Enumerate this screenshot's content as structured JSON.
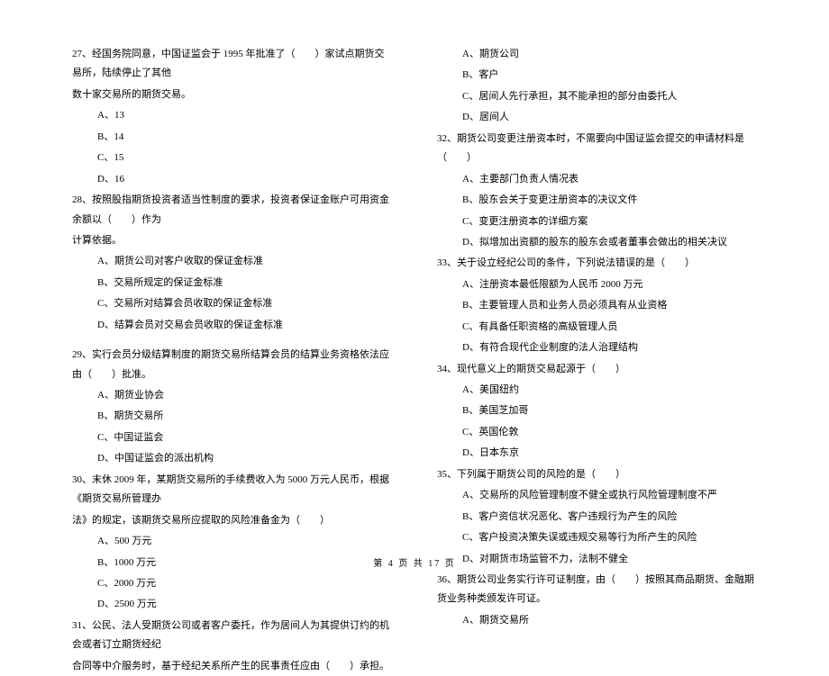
{
  "left_col": {
    "q27": {
      "text_l1": "27、经国务院同意，中国证监会于 1995 年批准了（　　）家试点期货交易所，陆续停止了其他",
      "text_l2": "数十家交易所的期货交易。",
      "opts": [
        "A、13",
        "B、14",
        "C、15",
        "D、16"
      ]
    },
    "q28": {
      "text_l1": "28、按照股指期货投资者适当性制度的要求，投资者保证金账户可用资金余额以（　　）作为",
      "text_l2": "计算依据。",
      "opts": [
        "A、期货公司对客户收取的保证金标准",
        "B、交易所规定的保证金标准",
        "C、交易所对结算会员收取的保证金标准",
        "D、结算会员对交易会员收取的保证金标准"
      ]
    },
    "q29": {
      "text": "29、实行会员分级结算制度的期货交易所结算会员的结算业务资格依法应由（　　）批准。",
      "opts": [
        "A、期货业协会",
        "B、期货交易所",
        "C、中国证监会",
        "D、中国证监会的派出机构"
      ]
    },
    "q30": {
      "text_l1": "30、末休 2009 年，某期货交易所的手续费收入为 5000 万元人民币，根据《期货交易所管理办",
      "text_l2": "法》的规定，该期货交易所应提取的风险准备金为（　　）",
      "opts": [
        "A、500 万元",
        "B、1000 万元",
        "C、2000 万元",
        "D、2500 万元"
      ]
    },
    "q31": {
      "text_l1": "31、公民、法人受期货公司或者客户委托，作为居间人为其提供订约的机会或者订立期货经纪",
      "text_l2": "合同等中介服务时，基于经纪关系所产生的民事责任应由（　　）承担。"
    }
  },
  "right_col": {
    "q31_opts": [
      "A、期货公司",
      "B、客户",
      "C、居间人先行承担，其不能承担的部分由委托人",
      "D、居间人"
    ],
    "q32": {
      "text": "32、期货公司变更注册资本时，不需要向中国证监会提交的申请材料是（　　）",
      "opts": [
        "A、主要部门负责人情况表",
        "B、股东会关于变更注册资本的决议文件",
        "C、变更注册资本的详细方案",
        "D、拟增加出资额的股东的股东会或者董事会做出的相关决议"
      ]
    },
    "q33": {
      "text": "33、关于设立经纪公司的条件，下列说法错误的是（　　）",
      "opts": [
        "A、注册资本最低限额为人民币 2000 万元",
        "B、主要管理人员和业务人员必须具有从业资格",
        "C、有具备任职资格的高级管理人员",
        "D、有符合现代企业制度的法人治理结构"
      ]
    },
    "q34": {
      "text": "34、现代意义上的期货交易起源于（　　）",
      "opts": [
        "A、美国纽约",
        "B、美国芝加哥",
        "C、英国伦敦",
        "D、日本东京"
      ]
    },
    "q35": {
      "text": "35、下列属于期货公司的风险的是（　　）",
      "opts": [
        "A、交易所的风险管理制度不健全或执行风险管理制度不严",
        "B、客户资信状况恶化、客户违规行为产生的风险",
        "C、客户投资决策失误或违规交易等行为所产生的风险",
        "D、对期货市场监管不力，法制不健全"
      ]
    },
    "q36": {
      "text": "36、期货公司业务实行许可证制度，由（　　）按照其商品期货、金融期货业务种类颁发许可证。",
      "opts_partial": [
        "A、期货交易所"
      ]
    }
  },
  "footer": "第 4 页 共 17 页"
}
